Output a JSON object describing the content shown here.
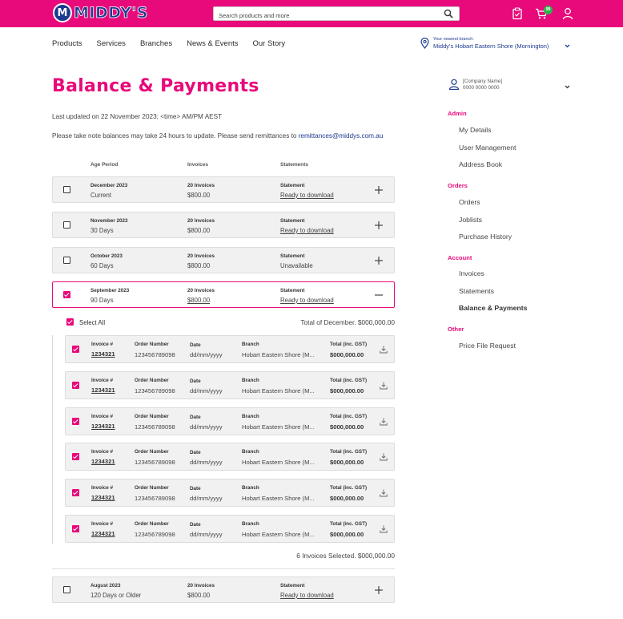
{
  "header": {
    "brand": "MIDDY'S",
    "search_placeholder": "Search products and more",
    "cart_count": "99",
    "icons": [
      "checklist-icon",
      "cart-icon",
      "user-icon",
      "search-icon"
    ],
    "colors": {
      "brand_pink": "#e8097a",
      "brand_blue": "#1c3a8f",
      "badge_green": "#2db34a"
    }
  },
  "nav": {
    "items": [
      "Products",
      "Services",
      "Branches",
      "News & Events",
      "Our Story"
    ],
    "branch_label": "Your nearest branch:",
    "branch_value": "Middy's Hobart Eastern Shore (Mornington)"
  },
  "page": {
    "title": "Balance & Payments",
    "updated": "Last updated on 22 November 2023; <time> AM/PM AEST",
    "note_prefix": "Please take note balances may take 24 hours to update. Please send remittances to ",
    "note_email": "remittances@middys.com.au"
  },
  "table": {
    "headers": {
      "age": "Age Period",
      "invoices": "Invoices",
      "statements": "Statements"
    },
    "statement_label": "Statement",
    "rows": [
      {
        "month": "December 2023",
        "age": "Current",
        "count": "20 Invoices",
        "amount": "$800.00",
        "status": "Ready to download",
        "checked": false,
        "expanded": false
      },
      {
        "month": "November 2023",
        "age": "30 Days",
        "count": "20 Invoices",
        "amount": "$800.00",
        "status": "Ready to download",
        "checked": false,
        "expanded": false
      },
      {
        "month": "October 2023",
        "age": "60 Days",
        "count": "20 Invoices",
        "amount": "$800.00",
        "status": "Unavailable",
        "checked": false,
        "expanded": false
      },
      {
        "month": "September 2023",
        "age": "90 Days",
        "count": "20 Invoices",
        "amount": "$800.00",
        "status": "Ready to download",
        "checked": true,
        "expanded": true
      },
      {
        "month": "August 2023",
        "age": "120 Days or Older",
        "count": "20 Invoices",
        "amount": "$800.00",
        "status": "Ready to download",
        "checked": false,
        "expanded": false
      }
    ]
  },
  "invoices": {
    "select_all_label": "Select All",
    "total_text": "Total of December. $000,000.00",
    "selected_text": "6 Invoices Selected. $000,000.00",
    "col_labels": {
      "invoice": "Invoice #",
      "order": "Order Number",
      "date": "Date",
      "branch": "Branch",
      "total": "Total (inc. GST)"
    },
    "rows": [
      {
        "invoice": "1234321",
        "order": "123456789098",
        "date": "dd/mm/yyyy",
        "branch": "Hobart Eastern Shore (M...",
        "total": "$000,000.00",
        "checked": true
      },
      {
        "invoice": "1234321",
        "order": "123456789098",
        "date": "dd/mm/yyyy",
        "branch": "Hobart Eastern Shore (M...",
        "total": "$000,000.00",
        "checked": true
      },
      {
        "invoice": "1234321",
        "order": "123456789098",
        "date": "dd/mm/yyyy",
        "branch": "Hobart Eastern Shore (M...",
        "total": "$000,000.00",
        "checked": true
      },
      {
        "invoice": "1234321",
        "order": "123456789098",
        "date": "dd/mm/yyyy",
        "branch": "Hobart Eastern Shore (M...",
        "total": "$000,000.00",
        "checked": true
      },
      {
        "invoice": "1234321",
        "order": "123456789098",
        "date": "dd/mm/yyyy",
        "branch": "Hobart Eastern Shore (M...",
        "total": "$000,000.00",
        "checked": true
      },
      {
        "invoice": "1234321",
        "order": "123456789098",
        "date": "dd/mm/yyyy",
        "branch": "Hobart Eastern Shore (M...",
        "total": "$000,000.00",
        "checked": true
      }
    ]
  },
  "sidebar": {
    "company_name": "[Company Name]",
    "company_number": "0000 0000 0000",
    "sections": [
      {
        "title": "Admin",
        "items": [
          "My Details",
          "User Management",
          "Address Book"
        ]
      },
      {
        "title": "Orders",
        "items": [
          "Orders",
          "Joblists",
          "Purchase History"
        ]
      },
      {
        "title": "Account",
        "items": [
          "Invoices",
          "Statements",
          "Balance & Payments"
        ]
      },
      {
        "title": "Other",
        "items": [
          "Price File Request"
        ]
      }
    ],
    "active_item": "Balance & Payments"
  }
}
